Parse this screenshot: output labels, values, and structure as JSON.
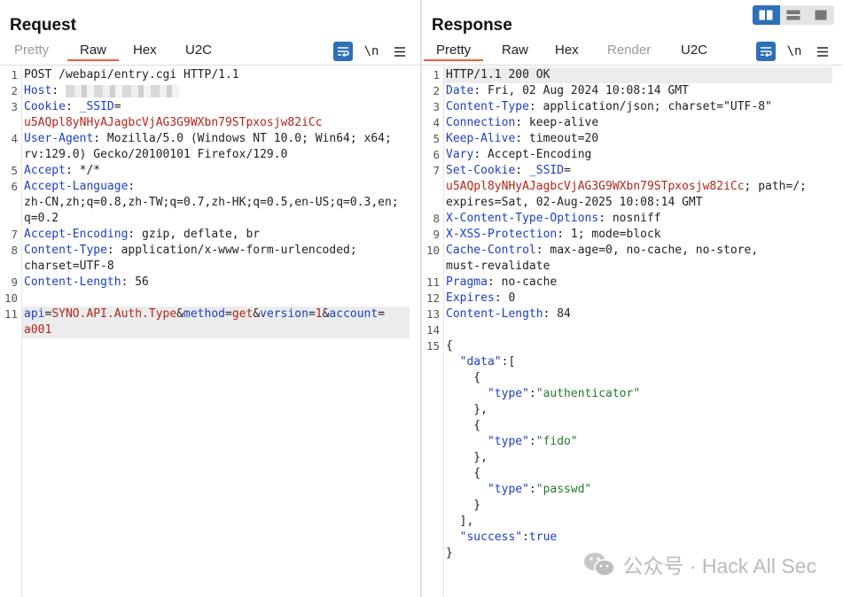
{
  "request": {
    "title": "Request",
    "tabs": [
      "Pretty",
      "Raw",
      "Hex",
      "U2C"
    ],
    "active_tab": "Raw",
    "newline_label": "\\n",
    "lines": [
      {
        "n": "1",
        "parts": [
          {
            "t": "POST /webapi/entry.cgi HTTP/1.1",
            "c": "v"
          }
        ]
      },
      {
        "n": "2",
        "parts": [
          {
            "t": "Host",
            "c": "k"
          },
          {
            "t": ": ",
            "c": "v"
          }
        ],
        "blurred": true
      },
      {
        "n": "3",
        "parts": [
          {
            "t": "Cookie",
            "c": "k"
          },
          {
            "t": ": ",
            "c": "v"
          },
          {
            "t": "_SSID",
            "c": "k"
          },
          {
            "t": "=",
            "c": "v"
          }
        ]
      },
      {
        "n": "",
        "parts": [
          {
            "t": "u5AQpl8yNHyAJagbcVjAG3G9WXbn79STpxosjw82iCc",
            "c": "red"
          }
        ]
      },
      {
        "n": "4",
        "parts": [
          {
            "t": "User-Agent",
            "c": "k"
          },
          {
            "t": ": Mozilla/5.0 (Windows NT 10.0; Win64; x64;",
            "c": "v"
          }
        ]
      },
      {
        "n": "",
        "parts": [
          {
            "t": "rv:129.0) Gecko/20100101 Firefox/129.0",
            "c": "v"
          }
        ]
      },
      {
        "n": "5",
        "parts": [
          {
            "t": "Accept",
            "c": "k"
          },
          {
            "t": ": */*",
            "c": "v"
          }
        ]
      },
      {
        "n": "6",
        "parts": [
          {
            "t": "Accept-Language",
            "c": "k"
          },
          {
            "t": ":",
            "c": "v"
          }
        ]
      },
      {
        "n": "",
        "parts": [
          {
            "t": "zh-CN,zh;q=0.8,zh-TW;q=0.7,zh-HK;q=0.5,en-US;q=0.3,en;",
            "c": "v"
          }
        ]
      },
      {
        "n": "",
        "parts": [
          {
            "t": "q=0.2",
            "c": "v"
          }
        ]
      },
      {
        "n": "7",
        "parts": [
          {
            "t": "Accept-Encoding",
            "c": "k"
          },
          {
            "t": ": gzip, deflate, br",
            "c": "v"
          }
        ]
      },
      {
        "n": "8",
        "parts": [
          {
            "t": "Content-Type",
            "c": "k"
          },
          {
            "t": ": application/x-www-form-urlencoded;",
            "c": "v"
          }
        ]
      },
      {
        "n": "",
        "parts": [
          {
            "t": "charset=UTF-8",
            "c": "v"
          }
        ]
      },
      {
        "n": "9",
        "parts": [
          {
            "t": "Content-Length",
            "c": "k"
          },
          {
            "t": ": 56",
            "c": "v"
          }
        ]
      },
      {
        "n": "10",
        "parts": []
      },
      {
        "n": "11",
        "parts": [
          {
            "t": "api",
            "c": "k"
          },
          {
            "t": "=",
            "c": "v"
          },
          {
            "t": "SYNO.API.Auth.Type",
            "c": "red"
          },
          {
            "t": "&",
            "c": "v"
          },
          {
            "t": "method",
            "c": "k"
          },
          {
            "t": "=",
            "c": "v"
          },
          {
            "t": "get",
            "c": "red"
          },
          {
            "t": "&",
            "c": "v"
          },
          {
            "t": "version",
            "c": "k"
          },
          {
            "t": "=",
            "c": "v"
          },
          {
            "t": "1",
            "c": "red"
          },
          {
            "t": "&",
            "c": "v"
          },
          {
            "t": "account",
            "c": "k"
          },
          {
            "t": "=",
            "c": "v"
          }
        ],
        "highlight": true
      },
      {
        "n": "",
        "parts": [
          {
            "t": "a001",
            "c": "red"
          }
        ],
        "highlight": true
      }
    ]
  },
  "response": {
    "title": "Response",
    "tabs": [
      "Pretty",
      "Raw",
      "Hex",
      "Render",
      "U2C"
    ],
    "active_tab": "Pretty",
    "disabled_tab": "Render",
    "newline_label": "\\n",
    "lines": [
      {
        "n": "1",
        "parts": [
          {
            "t": "HTTP/1.1 200 OK",
            "c": "v"
          }
        ],
        "highlight": true
      },
      {
        "n": "2",
        "parts": [
          {
            "t": "Date",
            "c": "k"
          },
          {
            "t": ": Fri, 02 Aug 2024 10:08:14 GMT",
            "c": "v"
          }
        ]
      },
      {
        "n": "3",
        "parts": [
          {
            "t": "Content-Type",
            "c": "k"
          },
          {
            "t": ": application/json; charset=\"UTF-8\"",
            "c": "v"
          }
        ]
      },
      {
        "n": "4",
        "parts": [
          {
            "t": "Connection",
            "c": "k"
          },
          {
            "t": ": keep-alive",
            "c": "v"
          }
        ]
      },
      {
        "n": "5",
        "parts": [
          {
            "t": "Keep-Alive",
            "c": "k"
          },
          {
            "t": ": timeout=20",
            "c": "v"
          }
        ]
      },
      {
        "n": "6",
        "parts": [
          {
            "t": "Vary",
            "c": "k"
          },
          {
            "t": ": Accept-Encoding",
            "c": "v"
          }
        ]
      },
      {
        "n": "7",
        "parts": [
          {
            "t": "Set-Cookie",
            "c": "k"
          },
          {
            "t": ": ",
            "c": "v"
          },
          {
            "t": "_SSID",
            "c": "k"
          },
          {
            "t": "=",
            "c": "v"
          }
        ]
      },
      {
        "n": "",
        "parts": [
          {
            "t": "u5AQpl8yNHyAJagbcVjAG3G9WXbn79STpxosjw82iCc",
            "c": "red"
          },
          {
            "t": "; path=/;",
            "c": "v"
          }
        ]
      },
      {
        "n": "",
        "parts": [
          {
            "t": "expires=Sat, 02-Aug-2025 10:08:14 GMT",
            "c": "v"
          }
        ]
      },
      {
        "n": "8",
        "parts": [
          {
            "t": "X-Content-Type-Options",
            "c": "k"
          },
          {
            "t": ": nosniff",
            "c": "v"
          }
        ]
      },
      {
        "n": "9",
        "parts": [
          {
            "t": "X-XSS-Protection",
            "c": "k"
          },
          {
            "t": ": 1; mode=block",
            "c": "v"
          }
        ]
      },
      {
        "n": "10",
        "parts": [
          {
            "t": "Cache-Control",
            "c": "k"
          },
          {
            "t": ": max-age=0, no-cache, no-store,",
            "c": "v"
          }
        ]
      },
      {
        "n": "",
        "parts": [
          {
            "t": "must-revalidate",
            "c": "v"
          }
        ]
      },
      {
        "n": "11",
        "parts": [
          {
            "t": "Pragma",
            "c": "k"
          },
          {
            "t": ": no-cache",
            "c": "v"
          }
        ]
      },
      {
        "n": "12",
        "parts": [
          {
            "t": "Expires",
            "c": "k"
          },
          {
            "t": ": 0",
            "c": "v"
          }
        ]
      },
      {
        "n": "13",
        "parts": [
          {
            "t": "Content-Length",
            "c": "k"
          },
          {
            "t": ": 84",
            "c": "v"
          }
        ]
      },
      {
        "n": "14",
        "parts": []
      },
      {
        "n": "15",
        "parts": [
          {
            "t": "{",
            "c": "v"
          }
        ]
      },
      {
        "n": "",
        "parts": [
          {
            "t": "  \"data\"",
            "c": "k"
          },
          {
            "t": ":[",
            "c": "v"
          }
        ]
      },
      {
        "n": "",
        "parts": [
          {
            "t": "    {",
            "c": "v"
          }
        ]
      },
      {
        "n": "",
        "parts": [
          {
            "t": "      \"type\"",
            "c": "k"
          },
          {
            "t": ":",
            "c": "v"
          },
          {
            "t": "\"authenticator\"",
            "c": "str"
          }
        ]
      },
      {
        "n": "",
        "parts": [
          {
            "t": "    },",
            "c": "v"
          }
        ]
      },
      {
        "n": "",
        "parts": [
          {
            "t": "    {",
            "c": "v"
          }
        ]
      },
      {
        "n": "",
        "parts": [
          {
            "t": "      \"type\"",
            "c": "k"
          },
          {
            "t": ":",
            "c": "v"
          },
          {
            "t": "\"fido\"",
            "c": "str"
          }
        ]
      },
      {
        "n": "",
        "parts": [
          {
            "t": "    },",
            "c": "v"
          }
        ]
      },
      {
        "n": "",
        "parts": [
          {
            "t": "    {",
            "c": "v"
          }
        ]
      },
      {
        "n": "",
        "parts": [
          {
            "t": "      \"type\"",
            "c": "k"
          },
          {
            "t": ":",
            "c": "v"
          },
          {
            "t": "\"passwd\"",
            "c": "str"
          }
        ]
      },
      {
        "n": "",
        "parts": [
          {
            "t": "    }",
            "c": "v"
          }
        ]
      },
      {
        "n": "",
        "parts": [
          {
            "t": "  ],",
            "c": "v"
          }
        ]
      },
      {
        "n": "",
        "parts": [
          {
            "t": "  \"success\"",
            "c": "k"
          },
          {
            "t": ":",
            "c": "v"
          },
          {
            "t": "true",
            "c": "num"
          }
        ]
      },
      {
        "n": "",
        "parts": [
          {
            "t": "}",
            "c": "v"
          }
        ]
      }
    ]
  },
  "watermark": {
    "text": "公众号 · Hack All Sec",
    "icon": "wechat-icon"
  },
  "colors": {
    "accent": "#2e6fb6",
    "tab_underline": "#e8603c",
    "key": "#1a3fc4",
    "value_red": "#b3251b",
    "string_green": "#267a2b"
  },
  "icons": [
    "wrap-lines-icon",
    "newline-icon",
    "menu-icon",
    "layout-split-icon",
    "layout-rows-icon",
    "layout-single-icon"
  ]
}
